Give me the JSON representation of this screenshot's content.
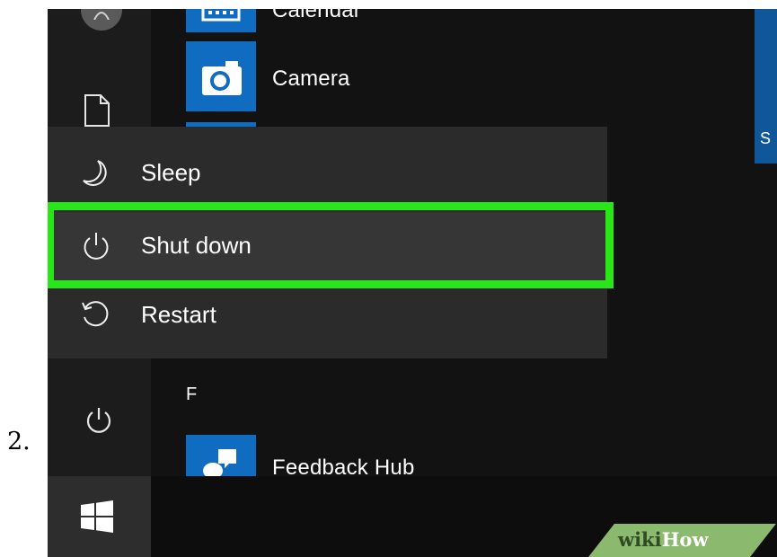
{
  "step": {
    "number": "2."
  },
  "start_menu": {
    "apps": [
      {
        "label": "Calendar",
        "icon": "calendar-icon"
      },
      {
        "label": "Camera",
        "icon": "camera-icon"
      }
    ],
    "section_letter": "F",
    "section_apps": [
      {
        "label": "Feedback Hub",
        "icon": "feedback-icon"
      }
    ],
    "right_tile_text": "S"
  },
  "power_menu": {
    "items": [
      {
        "label": "Sleep",
        "icon": "moon-icon"
      },
      {
        "label": "Shut down",
        "icon": "power-icon",
        "highlighted": true
      },
      {
        "label": "Restart",
        "icon": "restart-icon"
      }
    ]
  },
  "watermark": {
    "wiki": "wiki",
    "how": "How"
  },
  "colors": {
    "tile_blue": "#0f6cc0",
    "highlight_green": "#29e619",
    "menu_bg": "#2b2b2b"
  }
}
